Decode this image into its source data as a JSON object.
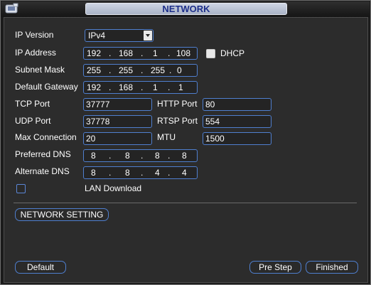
{
  "window": {
    "title": "NETWORK",
    "icon": "network-settings-icon"
  },
  "form": {
    "ip_version": {
      "label": "IP Version",
      "value": "IPv4"
    },
    "ip_address": {
      "label": "IP Address",
      "octets": [
        "192",
        "168",
        "1",
        "108"
      ]
    },
    "dhcp": {
      "label": "DHCP",
      "checked": false
    },
    "subnet_mask": {
      "label": "Subnet Mask",
      "octets": [
        "255",
        "255",
        "255",
        "0"
      ]
    },
    "default_gateway": {
      "label": "Default Gateway",
      "octets": [
        "192",
        "168",
        "1",
        "1"
      ]
    },
    "tcp_port": {
      "label": "TCP Port",
      "value": "37777"
    },
    "http_port": {
      "label": "HTTP Port",
      "value": "80"
    },
    "udp_port": {
      "label": "UDP Port",
      "value": "37778"
    },
    "rtsp_port": {
      "label": "RTSP Port",
      "value": "554"
    },
    "max_connection": {
      "label": "Max Connection",
      "value": "20"
    },
    "mtu": {
      "label": "MTU",
      "value": "1500"
    },
    "preferred_dns": {
      "label": "Preferred DNS",
      "octets": [
        "8",
        "8",
        "8",
        "8"
      ]
    },
    "alternate_dns": {
      "label": "Alternate DNS",
      "octets": [
        "8",
        "8",
        "4",
        "4"
      ]
    },
    "lan_download": {
      "label": "LAN Download",
      "checked": false
    },
    "network_setting_label": "NETWORK SETTING"
  },
  "buttons": {
    "default": "Default",
    "pre_step": "Pre Step",
    "finished": "Finished"
  },
  "colors": {
    "title_text": "#1d2f8a",
    "field_border": "#4f7fcf",
    "panel_bg": "#2c2c2c"
  }
}
